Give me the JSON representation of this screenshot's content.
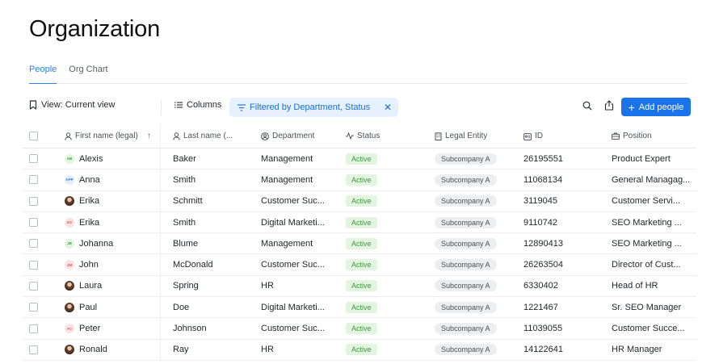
{
  "page_title": "Organization",
  "tabs": [
    {
      "label": "People",
      "active": true
    },
    {
      "label": "Org Chart",
      "active": false
    }
  ],
  "toolbar": {
    "view_label": "View: Current view",
    "columns_label": "Columns",
    "filter_label": "Filtered by Department, Status",
    "filter_close": "✕",
    "add_label": "Add people",
    "add_icon": "+",
    "accent": "#1a73e8"
  },
  "table": {
    "headers": {
      "first": "First name (legal)",
      "last": "Last name (...",
      "dept": "Department",
      "status": "Status",
      "legal": "Legal Entity",
      "id": "ID",
      "position": "Position"
    },
    "sort_indicator": "↑",
    "rows": [
      {
        "avatar": "AB",
        "avatar_style": "green",
        "first": "Alexis",
        "last": "Baker",
        "dept": "Management",
        "status": "Active",
        "legal": "Subcompany A",
        "id": "26195551",
        "position": "Product Expert"
      },
      {
        "avatar": "APP",
        "avatar_style": "blue",
        "first": "Anna",
        "last": "Smith",
        "dept": "Management",
        "status": "Active",
        "legal": "Subcompany A",
        "id": "11068134",
        "position": "General Managag..."
      },
      {
        "avatar": "",
        "avatar_style": "photo",
        "first": "Erika",
        "last": "Schmitt",
        "dept": "Customer Suc...",
        "status": "Active",
        "legal": "Subcompany A",
        "id": "3119045",
        "position": "Customer Servi..."
      },
      {
        "avatar": "ES",
        "avatar_style": "red",
        "first": "Erika",
        "last": "Smith",
        "dept": "Digital Marketi...",
        "status": "Active",
        "legal": "Subcompany A",
        "id": "9110742",
        "position": "SEO Marketing ..."
      },
      {
        "avatar": "JB",
        "avatar_style": "green",
        "first": "Johanna",
        "last": "Blume",
        "dept": "Management",
        "status": "Active",
        "legal": "Subcompany A",
        "id": "12890413",
        "position": "SEO Marketing ..."
      },
      {
        "avatar": "JM",
        "avatar_style": "red",
        "first": "John",
        "last": "McDonald",
        "dept": "Customer Suc...",
        "status": "Active",
        "legal": "Subcompany A",
        "id": "26263504",
        "position": "Director of Cust..."
      },
      {
        "avatar": "",
        "avatar_style": "photo",
        "first": "Laura",
        "last": "Spring",
        "dept": "HR",
        "status": "Active",
        "legal": "Subcompany A",
        "id": "6330402",
        "position": "Head of HR"
      },
      {
        "avatar": "",
        "avatar_style": "photo",
        "first": "Paul",
        "last": "Doe",
        "dept": "Digital Marketi...",
        "status": "Active",
        "legal": "Subcompany A",
        "id": "1221467",
        "position": "Sr. SEO Manager"
      },
      {
        "avatar": "PJ",
        "avatar_style": "red",
        "first": "Peter",
        "last": "Johnson",
        "dept": "Customer Suc...",
        "status": "Active",
        "legal": "Subcompany A",
        "id": "11039055",
        "position": "Customer Succe..."
      },
      {
        "avatar": "",
        "avatar_style": "photo",
        "first": "Ronald",
        "last": "Ray",
        "dept": "HR",
        "status": "Active",
        "legal": "Subcompany A",
        "id": "14122641",
        "position": "HR Manager"
      }
    ]
  }
}
